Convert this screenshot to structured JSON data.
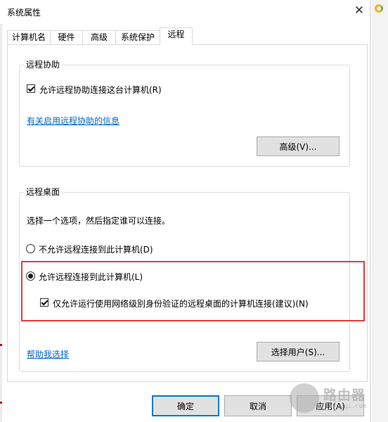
{
  "window": {
    "title": "系统属性"
  },
  "tabs": [
    {
      "label": "计算机名"
    },
    {
      "label": "硬件"
    },
    {
      "label": "高级"
    },
    {
      "label": "系统保护"
    },
    {
      "label": "远程",
      "active": true
    }
  ],
  "remote_assistance": {
    "legend": "远程协助",
    "allow_checkbox_label": "允许远程协助连接这台计算机(R)",
    "allow_checked": true,
    "info_link": "有关启用远程协助的信息",
    "advanced_button": "高级(V)..."
  },
  "remote_desktop": {
    "legend": "远程桌面",
    "instruction": "选择一个选项，然后指定谁可以连接。",
    "option_disallow": "不允许远程连接到此计算机(D)",
    "option_allow": "允许远程连接到此计算机(L)",
    "selected_option": "allow",
    "nla_checkbox_label": "仅允许运行使用网络级别身份验证的远程桌面的计算机连接(建议)(N)",
    "nla_checked": true,
    "help_link": "帮助我选择",
    "select_users_button": "选择用户(S)..."
  },
  "footer": {
    "ok_button": "确定",
    "cancel_button": "取消",
    "apply_button": "应用(A)"
  },
  "watermark": {
    "text": "路由器",
    "url": "luyouqi.com"
  },
  "colors": {
    "link": "#0066cc",
    "highlight_border": "#e23d3d",
    "default_button_border": "#0078d7"
  }
}
